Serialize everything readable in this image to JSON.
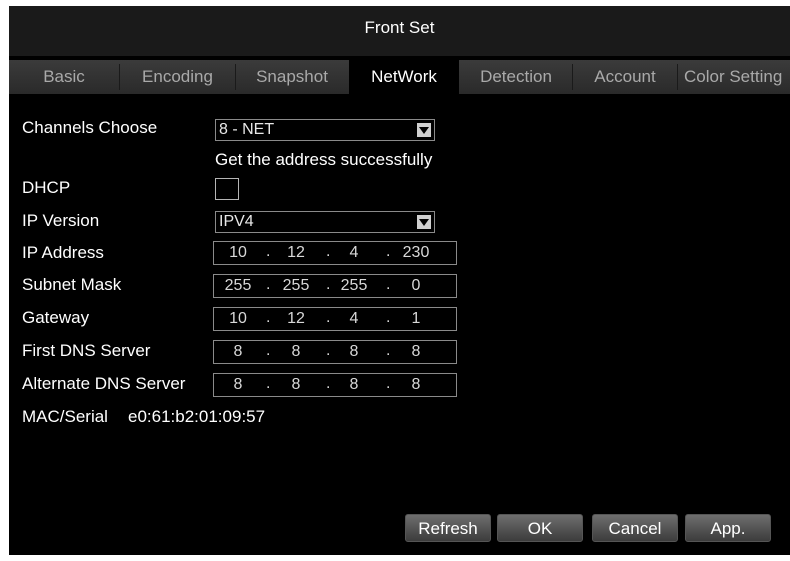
{
  "window": {
    "title": "Front Set"
  },
  "tabs": [
    {
      "label": "Basic"
    },
    {
      "label": "Encoding"
    },
    {
      "label": "Snapshot"
    },
    {
      "label": "NetWork",
      "active": true
    },
    {
      "label": "Detection"
    },
    {
      "label": "Account"
    },
    {
      "label": "Color Setting"
    }
  ],
  "form": {
    "channels_label": "Channels Choose",
    "channels_value": "8 - NET",
    "status_message": "Get the address successfully",
    "dhcp_label": "DHCP",
    "dhcp_checked": false,
    "ip_version_label": "IP Version",
    "ip_version_value": "IPV4",
    "ip_address_label": "IP Address",
    "ip_address": [
      "10",
      "12",
      "4",
      "230"
    ],
    "subnet_label": "Subnet Mask",
    "subnet": [
      "255",
      "255",
      "255",
      "0"
    ],
    "gateway_label": "Gateway",
    "gateway": [
      "10",
      "12",
      "4",
      "1"
    ],
    "dns1_label": "First DNS Server",
    "dns1": [
      "8",
      "8",
      "8",
      "8"
    ],
    "dns2_label": "Alternate DNS Server",
    "dns2": [
      "8",
      "8",
      "8",
      "8"
    ],
    "mac_label": "MAC/Serial",
    "mac_value": "e0:61:b2:01:09:57"
  },
  "buttons": {
    "refresh": "Refresh",
    "ok": "OK",
    "cancel": "Cancel",
    "apply": "App."
  },
  "icons": {
    "dropdown": "chevron-down-icon"
  }
}
